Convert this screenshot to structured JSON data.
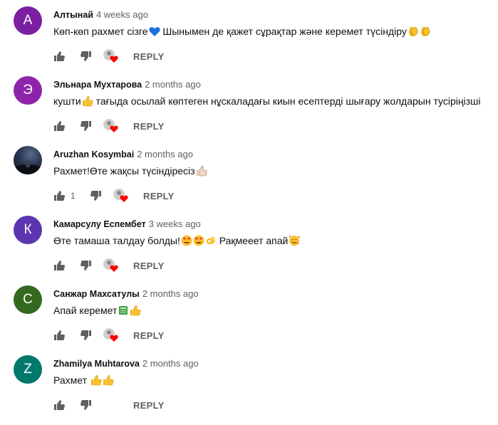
{
  "colors": {
    "purple_avatar": "#7b1fa2",
    "magenta_avatar": "#8e24aa",
    "indigo_avatar": "#5e35b1",
    "green_avatar": "#33691e",
    "teal_avatar": "#00796b",
    "heart": "#ff0000",
    "meta": "#606060"
  },
  "comments": [
    {
      "avatar_letter": "A",
      "author": "Алтынай",
      "time": "4 weeks ago",
      "text": "Көп-көп рахмет сізге",
      "text_after": " Шынымен де қажет сұрақтар және керемет түсіндіру",
      "emojis": [
        "blue-heart",
        "clapping-hands",
        "clapping-hands"
      ],
      "likes": "",
      "hearted": true,
      "reply": "REPLY"
    },
    {
      "avatar_letter": "Э",
      "author": "Эльнара Мухтарова",
      "time": "2 months ago",
      "text": "кушти",
      "text_after": " тағыда осылай  көптеген нұскаладағы киын есептерді шығару жолдарын тусіріңізші",
      "emojis": [
        "thumbs-up"
      ],
      "likes": "",
      "hearted": true,
      "reply": "REPLY"
    },
    {
      "avatar_letter": "",
      "author": "Aruzhan Kosymbai",
      "time": "2 months ago",
      "text": "Рахмет!Өте жақсы түсіндіресіз",
      "text_after": "",
      "emojis": [
        "thumbs-up-light"
      ],
      "likes": "1",
      "hearted": true,
      "reply": "REPLY"
    },
    {
      "avatar_letter": "К",
      "author": "Камарсулу Еспембет",
      "time": "3 weeks ago",
      "text": "Өте тамаша талдау болды!",
      "text_after": " Рақмееет апай",
      "emojis": [
        "heart-eyes",
        "heart-eyes",
        "ok-hand",
        "smiling-hearts"
      ],
      "likes": "",
      "hearted": true,
      "reply": "REPLY"
    },
    {
      "avatar_letter": "С",
      "author": "Санжар Махсатулы",
      "time": "2 months ago",
      "text": "Апай керемет",
      "text_after": "",
      "emojis": [
        "green-book",
        "thumbs-up"
      ],
      "likes": "",
      "hearted": true,
      "reply": "REPLY"
    },
    {
      "avatar_letter": "Z",
      "author": "Zhamilya Muhtarova",
      "time": "2 months ago",
      "text": "Рахмет ",
      "text_after": "",
      "emojis": [
        "thumbs-up",
        "thumbs-up"
      ],
      "likes": "",
      "hearted": false,
      "reply": "REPLY"
    }
  ]
}
